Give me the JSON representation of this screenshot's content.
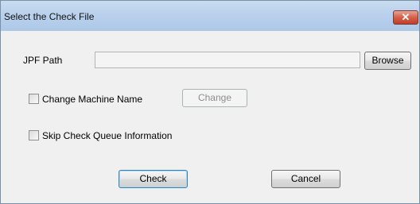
{
  "window": {
    "title": "Select the Check File",
    "close_glyph": "✕"
  },
  "form": {
    "jpf_path_label": "JPF  Path",
    "jpf_path_value": "",
    "browse_label": "Browse",
    "change_machine_label": "Change Machine Name",
    "change_machine_checked": false,
    "change_label": "Change",
    "skip_queue_label": "Skip Check Queue Information",
    "skip_queue_checked": false
  },
  "footer": {
    "check_label": "Check",
    "cancel_label": "Cancel"
  }
}
